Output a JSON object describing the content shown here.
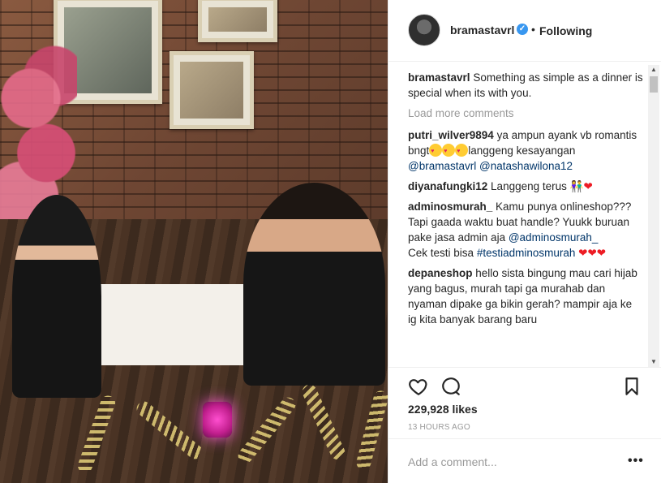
{
  "post": {
    "username": "bramastavrl",
    "follow_status": "Following",
    "separator": "•",
    "verified_mark": "✓",
    "caption_user": "bramastavrl",
    "caption_text": "Something as simple as a dinner is special when its with you.",
    "load_more": "Load more comments",
    "likes": "229,928 likes",
    "time": "13 HOURS AGO",
    "comment_placeholder": "Add a comment...",
    "more_options": "•••"
  },
  "comments": [
    {
      "user": "putri_wilver9894",
      "text_a": "ya ampun ayank vb romantis bngt",
      "text_b": "langgeng kesayangan",
      "mention_1": "@bramastavrl",
      "mention_2": "@natashawilona12"
    },
    {
      "user": "diyanafungki12",
      "text": "Langgeng terus"
    },
    {
      "user": "adminosmurah_",
      "text_a": "Kamu punya onlineshop??? Tapi gaada waktu buat handle? Yuukk buruan pake jasa admin aja",
      "mention": "@adminosmurah_",
      "text_b": "Cek testi bisa",
      "hashtag": "#testiadminosmurah"
    },
    {
      "user": "depaneshop",
      "text": "hello sista bingung mau cari hijab yang bagus, murah tapi ga murahab dan nyaman dipake ga bikin gerah? mampir aja ke ig kita banyak barang baru"
    }
  ],
  "icons": {
    "like": "heart-outline-icon",
    "comment": "comment-bubble-icon",
    "save": "bookmark-icon",
    "verified": "verified-badge-icon"
  },
  "colors": {
    "verified": "#3897f0",
    "mention": "#003569",
    "heart": "#ed1c24",
    "muted": "#999999"
  }
}
